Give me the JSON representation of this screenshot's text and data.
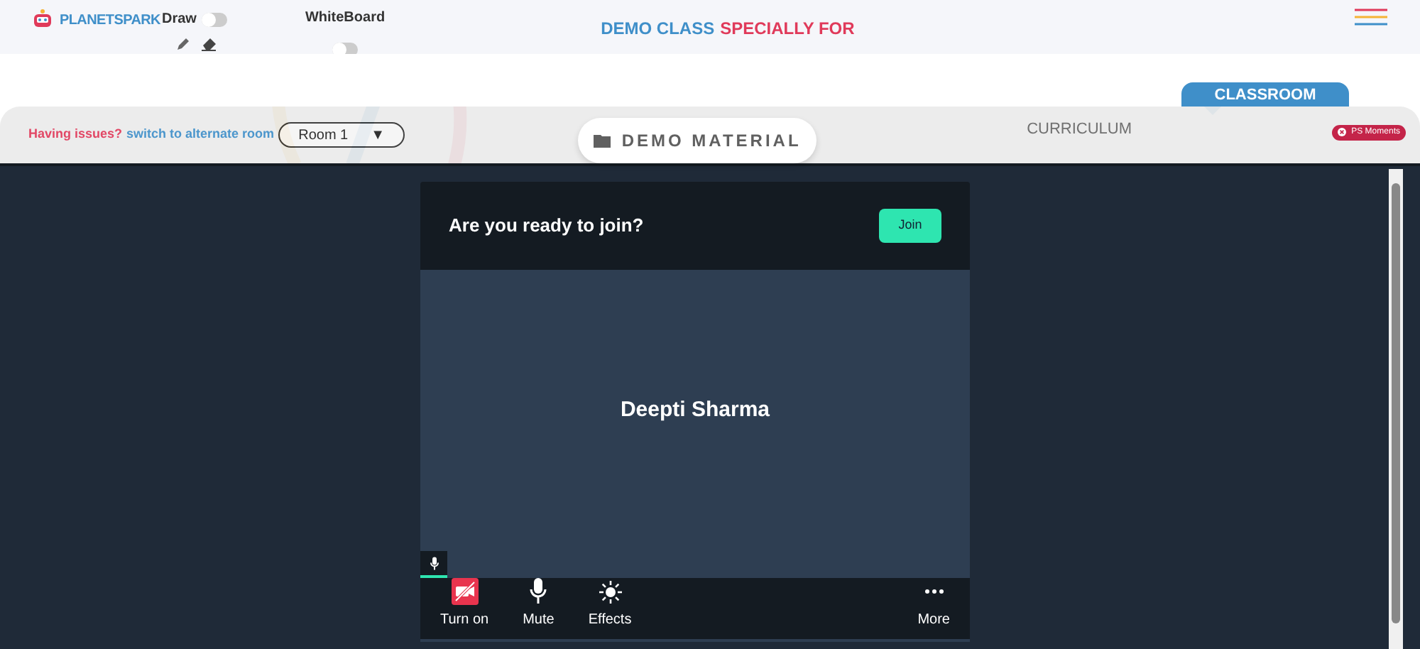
{
  "header": {
    "logo": "PLANETSPARK",
    "toggles": [
      {
        "label": "Draw",
        "on": false
      },
      {
        "label": "WhiteBoard",
        "on": false
      }
    ],
    "title_parts": [
      {
        "text": "DEMO CLASS",
        "color": "#3f8fc9"
      },
      {
        "text": "SPECIALLY FOR",
        "color": "#e03a5a"
      }
    ]
  },
  "tabs": [
    {
      "label": "DEMO MATERIAL",
      "kind": "pill",
      "selected": false
    },
    {
      "label": "CURRICULUM",
      "kind": "plain",
      "selected": false
    },
    {
      "label": "CLASSROOM",
      "kind": "flag",
      "selected": true
    }
  ],
  "issue_bar": {
    "warning": "Having issues?",
    "link": "switch to alternate room",
    "room": "Room 1",
    "room_caret": "▼",
    "badge": "PS Moments"
  },
  "meeting": {
    "prompt": "Are you ready to join?",
    "join_button": "Join",
    "participant": "Deepti Sharma",
    "controls": [
      {
        "label": "Turn on",
        "kind": "camera"
      },
      {
        "label": "Mute",
        "kind": "mic"
      },
      {
        "label": "Effects",
        "kind": "effects"
      },
      {
        "label": "More",
        "kind": "more"
      }
    ]
  }
}
